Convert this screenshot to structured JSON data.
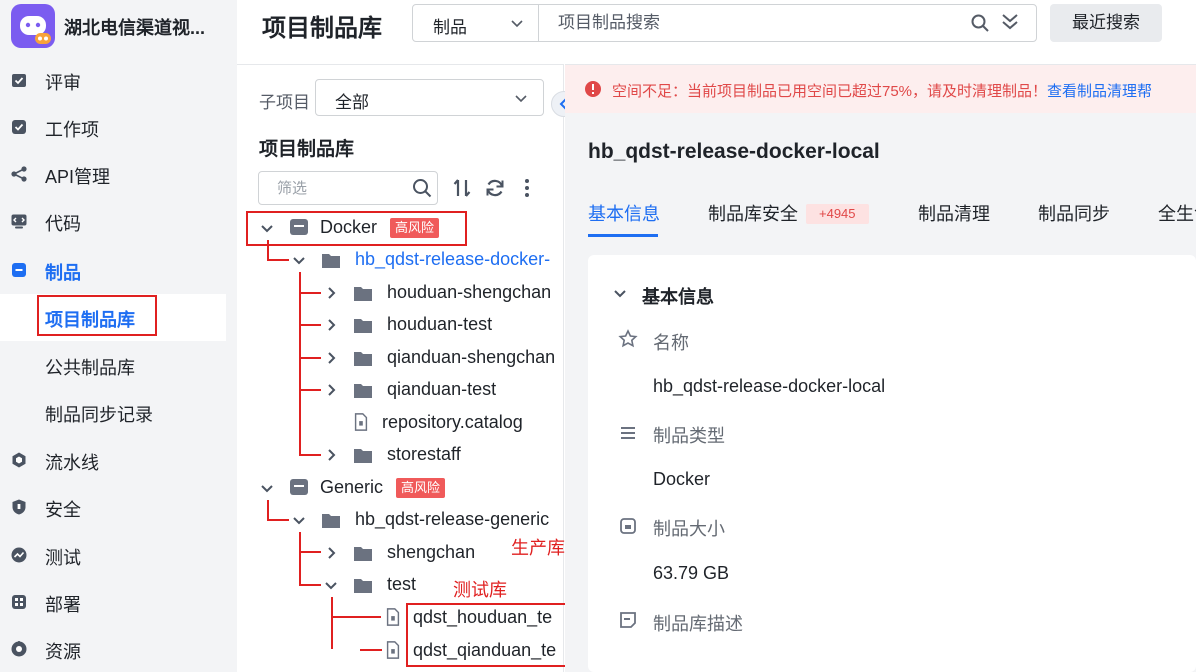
{
  "app": {
    "title": "湖北电信渠道视..."
  },
  "nav": {
    "items": [
      {
        "label": "评审",
        "icon": "review-icon"
      },
      {
        "label": "工作项",
        "icon": "workitem-icon"
      },
      {
        "label": "API管理",
        "icon": "share-icon"
      },
      {
        "label": "代码",
        "icon": "code-icon"
      },
      {
        "label": "制品",
        "icon": "artifact-icon"
      },
      {
        "label": "流水线",
        "icon": "pipeline-icon"
      },
      {
        "label": "安全",
        "icon": "shield-icon"
      },
      {
        "label": "测试",
        "icon": "test-icon"
      },
      {
        "label": "部署",
        "icon": "deploy-icon"
      },
      {
        "label": "资源",
        "icon": "resource-icon"
      }
    ],
    "sub_items": [
      {
        "label": "项目制品库"
      },
      {
        "label": "公共制品库"
      },
      {
        "label": "制品同步记录"
      }
    ]
  },
  "header": {
    "title": "项目制品库",
    "search_scope": "制品",
    "search_placeholder": "项目制品搜索",
    "recent_search": "最近搜索"
  },
  "tree_panel": {
    "subproject_label": "子项目",
    "subproject_value": "全部",
    "title": "项目制品库",
    "filter_placeholder": "筛选",
    "risk_label": "高风险",
    "nodes": {
      "docker": "Docker",
      "docker_repo": "hb_qdst-release-docker-",
      "houduan_shengchan": "houduan-shengchan",
      "houduan_test": "houduan-test",
      "qianduan_shengchan": "qianduan-shengchan",
      "qianduan_test": "qianduan-test",
      "repository_catalog": "repository.catalog",
      "storestaff": "storestaff",
      "generic": "Generic",
      "generic_repo": "hb_qdst-release-generic",
      "shengchan": "shengchan",
      "test": "test",
      "qdst_houduan": "qdst_houduan_te",
      "qdst_qianduan": "qdst_qianduan_te"
    },
    "annotations": {
      "production": "生产库",
      "testing": "测试库"
    }
  },
  "detail": {
    "warning_text": "空间不足：当前项目制品已用空间已超过75%，请及时清理制品！",
    "warning_link": "查看制品清理帮",
    "repo_title": "hb_qdst-release-docker-local",
    "tabs": [
      "基本信息",
      "制品库安全",
      "制品清理",
      "制品同步",
      "全生命"
    ],
    "security_badge": "+4945",
    "section_title": "基本信息",
    "fields": [
      {
        "label": "名称",
        "value": "hb_qdst-release-docker-local",
        "icon": "star-icon"
      },
      {
        "label": "制品类型",
        "value": "Docker",
        "icon": "list-icon"
      },
      {
        "label": "制品大小",
        "value": "63.79 GB",
        "icon": "size-icon"
      },
      {
        "label": "制品库描述",
        "value": "",
        "icon": "note-icon"
      }
    ]
  },
  "colors": {
    "accent": "#1e6ef2",
    "danger": "#e02020",
    "risk_badge": "#f05a5a",
    "nav_bg": "#f3f4f6"
  }
}
